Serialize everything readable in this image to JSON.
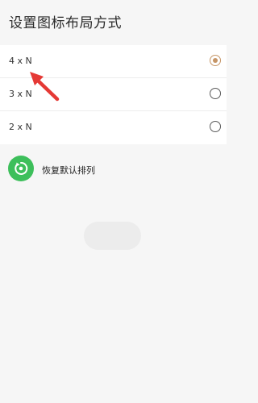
{
  "header": {
    "title": "设置图标布局方式"
  },
  "options": [
    {
      "label": "4 x N",
      "selected": true
    },
    {
      "label": "3 x N",
      "selected": false
    },
    {
      "label": "2 x N",
      "selected": false
    }
  ],
  "restore": {
    "label": "恢复默认排列",
    "icon": "restore-icon"
  },
  "colors": {
    "accent": "#c69566",
    "restore_green": "#3dbf5b",
    "annotation_red": "#e53935"
  }
}
